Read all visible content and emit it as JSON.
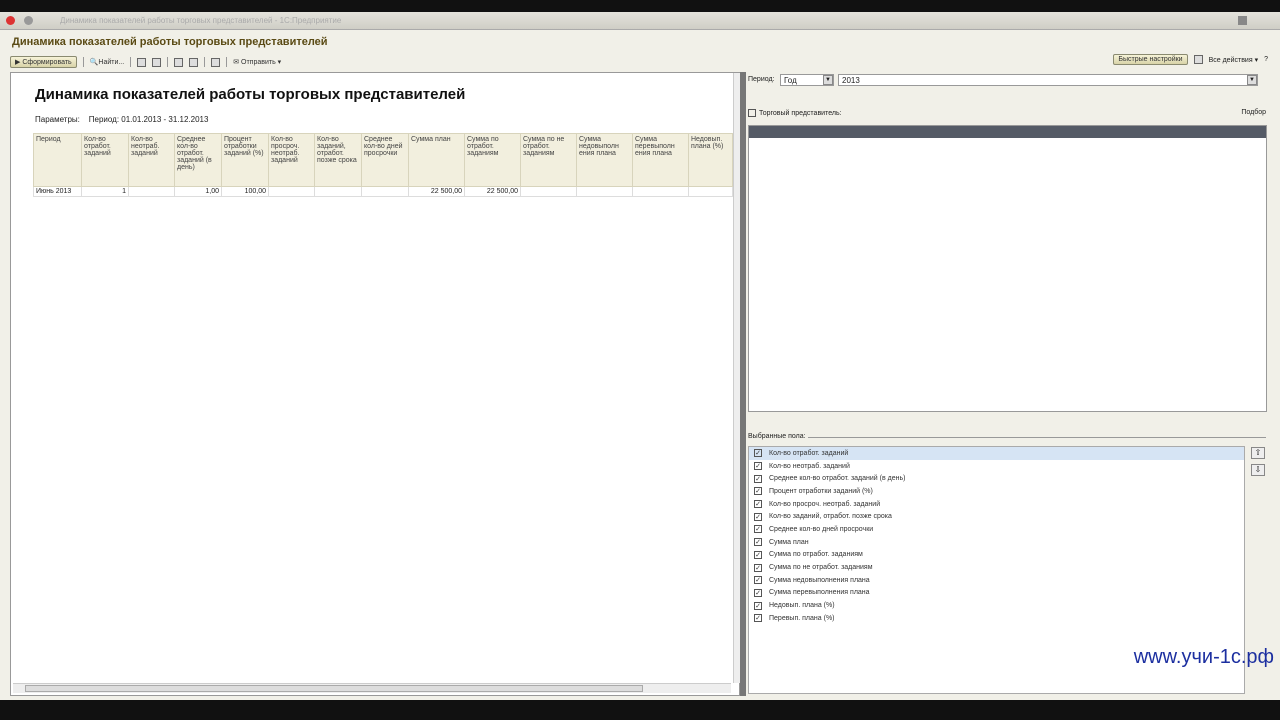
{
  "window": {
    "title": "Динамика показателей работы торговых представителей - 1С:Предприятие"
  },
  "form": {
    "title": "Динамика показателей работы торговых представителей"
  },
  "toolbar": {
    "generate": "Сформировать",
    "find": "Найти...",
    "send": "Отправить"
  },
  "report": {
    "title": "Динамика показателей работы торговых представителей",
    "params_label": "Параметры:",
    "params_value": "Период: 01.01.2013 - 31.12.2013",
    "columns": [
      "Период",
      "Кол-во отработ. заданий",
      "Кол-во неотраб. заданий",
      "Среднее кол-во отработ. заданий (в день)",
      "Процент отработки заданий (%)",
      "Кол-во просроч. неотраб. заданий",
      "Кол-во заданий, отработ. позже срока",
      "Среднее кол-во дней просрочки",
      "Сумма план",
      "Сумма по отработ. заданиям",
      "Сумма по не отработ. заданиям",
      "Сумма недовыполн ения плана",
      "Сумма перевыполн ения плана",
      "Недовып. плана (%)"
    ],
    "rows": [
      [
        "Июнь 2013",
        "1",
        "",
        "1,00",
        "100,00",
        "",
        "",
        "",
        "22 500,00",
        "22 500,00",
        "",
        "",
        "",
        ""
      ]
    ]
  },
  "settings": {
    "quick_settings": "Быстрые настройки",
    "all_actions": "Все действия",
    "period_label": "Период:",
    "period_type": "Год",
    "period_value": "2013",
    "rep_label": "Торговый представитель:",
    "rep_checked": false,
    "pick": "Подбор",
    "selected_label": "Выбранные пола:",
    "fields": [
      {
        "label": "Кол-во отработ. заданий",
        "checked": true
      },
      {
        "label": "Кол-во неотраб. заданий",
        "checked": true
      },
      {
        "label": "Среднее кол-во отработ. заданий (в день)",
        "checked": true
      },
      {
        "label": "Процент отработки заданий (%)",
        "checked": true
      },
      {
        "label": "Кол-во просроч. неотраб. заданий",
        "checked": true
      },
      {
        "label": "Кол-во заданий, отработ. позже срока",
        "checked": true
      },
      {
        "label": "Среднее кол-во дней просрочки",
        "checked": true
      },
      {
        "label": "Сумма план",
        "checked": true
      },
      {
        "label": "Сумма по отработ. заданиям",
        "checked": true
      },
      {
        "label": "Сумма по не отработ. заданиям",
        "checked": true
      },
      {
        "label": "Сумма недовыполнения плана",
        "checked": true
      },
      {
        "label": "Сумма перевыполнения плана",
        "checked": true
      },
      {
        "label": "Недовып. плана (%)",
        "checked": true
      },
      {
        "label": "Перевып. плана (%)",
        "checked": true
      }
    ]
  },
  "watermark": "www.учи-1с.рф",
  "colors": {
    "form_title": "#5a4a14",
    "watermark": "#1c2fa0",
    "selection": "#d6e4f4"
  }
}
